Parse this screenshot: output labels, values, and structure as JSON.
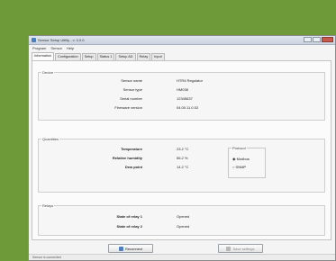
{
  "window": {
    "title": "Sensor Setup Utility - v. 0.0.0"
  },
  "menu": [
    "Program",
    "Sensor",
    "Help"
  ],
  "tabs": [
    "Information",
    "Configuration",
    "Setup",
    "Status 1",
    "Setup AD",
    "Relay",
    "Input"
  ],
  "device": {
    "title": "Device",
    "rows": [
      {
        "label": "Sensor name",
        "value": "HTR4 Regulator"
      },
      {
        "label": "Sensor type",
        "value": "HM038"
      },
      {
        "label": "Serial number",
        "value": "12345637"
      },
      {
        "label": "Firmware version",
        "value": "04.00.11.0.02"
      }
    ]
  },
  "quantities": {
    "title": "Quantities",
    "rows": [
      {
        "label": "Temperature",
        "value": "23.2 °C"
      },
      {
        "label": "Relative humidity",
        "value": "56.2 %"
      },
      {
        "label": "Dew point",
        "value": "14.2 °C"
      }
    ],
    "protocol": {
      "title": "Protocol",
      "options": [
        "Modbus",
        "SNMP"
      ],
      "selected": "Modbus"
    }
  },
  "relays": {
    "title": "Relays",
    "rows": [
      {
        "label": "State of relay 1",
        "value": "Opened"
      },
      {
        "label": "State of relay 2",
        "value": "Opened"
      }
    ]
  },
  "buttons": {
    "left": "Reconnect",
    "right": "Save settings"
  },
  "status": {
    "text": "Sensor is connected"
  }
}
